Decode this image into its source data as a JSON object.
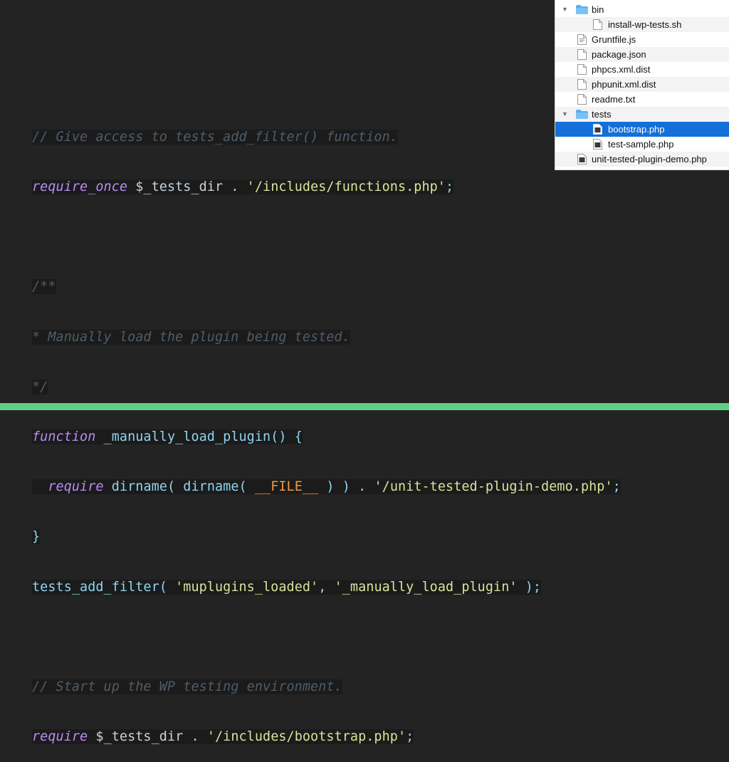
{
  "code_lines": [
    "// Give access to tests_add_filter() function.",
    "require_once",
    " $_tests_dir . ",
    "'/includes/functions.php'",
    ";",
    "/**",
    "* Manually load the plugin being tested.",
    "*/",
    "function",
    " _manually_load_plugin() {",
    "  ",
    "require",
    " dirname( dirname( ",
    "__FILE__",
    " ) ) . ",
    "'/unit-tested-plugin-demo.php'",
    ";",
    "}",
    "tests_add_filter( ",
    "'muplugins_loaded'",
    ", ",
    "'_manually_load_plugin'",
    " );",
    "// Start up the WP testing environment.",
    "require",
    " $_tests_dir . ",
    "'/includes/bootstrap.php'",
    ";"
  ],
  "file_tree": [
    {
      "label": "bin",
      "type": "folder",
      "expanded": true
    },
    {
      "label": "install-wp-tests.sh",
      "type": "file"
    },
    {
      "label": "Gruntfile.js",
      "type": "file"
    },
    {
      "label": "package.json",
      "type": "file"
    },
    {
      "label": "phpcs.xml.dist",
      "type": "file"
    },
    {
      "label": "phpunit.xml.dist",
      "type": "file"
    },
    {
      "label": "readme.txt",
      "type": "file"
    },
    {
      "label": "tests",
      "type": "folder",
      "expanded": true
    },
    {
      "label": "bootstrap.php",
      "type": "php-file",
      "selected": true
    },
    {
      "label": "test-sample.php",
      "type": "php-file"
    },
    {
      "label": "unit-tested-plugin-demo.php",
      "type": "php-file"
    }
  ],
  "colors": {
    "background": "#232323",
    "comment": "#4f5d6a",
    "keyword": "#b98cf5",
    "string": "#d5e59a",
    "constant": "#f09a47",
    "identifier": "#8fd5f2",
    "selection": "#1470d8",
    "accent_bar": "#5fcf86"
  }
}
